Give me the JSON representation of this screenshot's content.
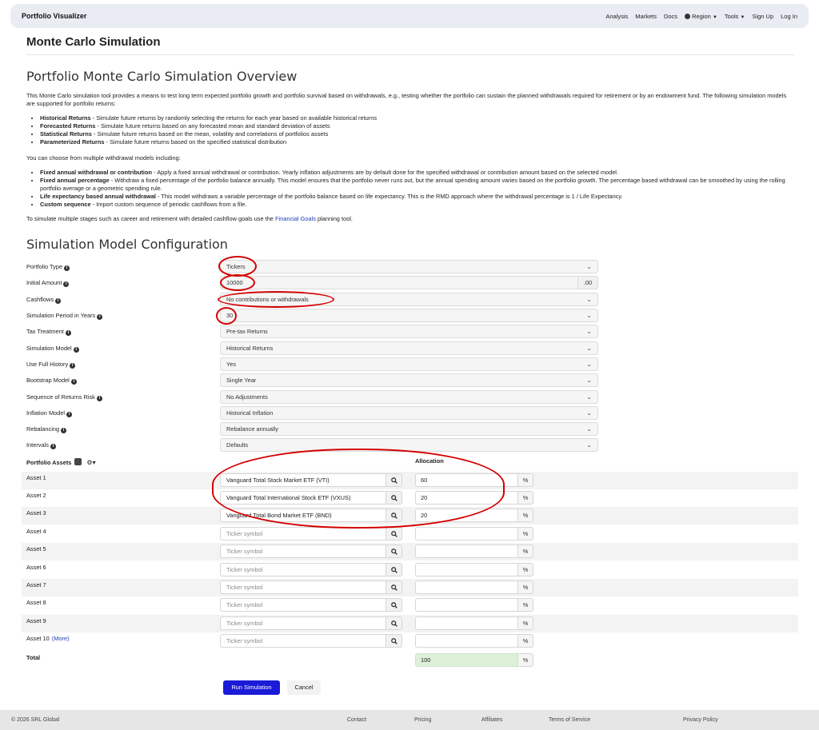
{
  "navbar": {
    "brand": "Portfolio Visualizer",
    "links": [
      "Analysis",
      "Markets",
      "Docs",
      "Region",
      "Tools",
      "Sign Up",
      "Log In"
    ]
  },
  "page_title": "Monte Carlo Simulation",
  "overview": {
    "title": "Portfolio Monte Carlo Simulation Overview",
    "intro": "This Monte Carlo simulation tool provides a means to test long term expected portfolio growth and portfolio survival based on withdrawals, e.g., testing whether the portfolio can sustain the planned withdrawals required for retirement or by an endowment fund. The following simulation models are supported for portfolio returns:",
    "models": [
      {
        "term": "Historical Returns",
        "desc": " - Simulate future returns by randomly selecting the returns for each year based on available historical returns"
      },
      {
        "term": "Forecasted Returns",
        "desc": " - Simulate future returns based on any forecasted mean and standard deviation of assets"
      },
      {
        "term": "Statistical Returns",
        "desc": " - Simulate future returns based on the mean, volatility and correlations of portfolios assets"
      },
      {
        "term": "Parameterized Returns",
        "desc": " - Simulate future returns based on the specified statistical distribution"
      }
    ],
    "withdrawal_intro": "You can choose from multiple withdrawal models including:",
    "withdrawals": [
      {
        "term": "Fixed annual withdrawal or contribution",
        "desc": " - Apply a fixed annual withdrawal or contribution. Yearly inflation adjustments are by default done for the specified withdrawal or contribution amount based on the selected model."
      },
      {
        "term": "Fixed annual percentage",
        "desc": " - Withdraw a fixed percentage of the portfolio balance annually. This model ensures that the portfolio never runs out, but the annual spending amount varies based on the portfolio growth. The percentage based withdrawal can be smoothed by using the rolling portfolio average or a geometric spending rule."
      },
      {
        "term": "Life expectancy based annual withdrawal",
        "desc": " - This model withdraws a variable percentage of the portfolio balance based on life expectancy. This is the RMD approach where the withdrawal percentage is 1 / Life Expectancy."
      },
      {
        "term": "Custom sequence",
        "desc": " - Import custom sequence of periodic cashflows from a file."
      }
    ],
    "stages_pre": "To simulate multiple stages such as career and retirement with detailed cashflow goals use the ",
    "stages_link": "Financial Goals",
    "stages_post": " planning tool."
  },
  "config": {
    "title": "Simulation Model Configuration",
    "fields": [
      {
        "label": "Portfolio Type",
        "value": "Tickers"
      },
      {
        "label": "Initial Amount",
        "value": "10000",
        "suffix": ".00"
      },
      {
        "label": "Cashflows",
        "value": "No contributions or withdrawals"
      },
      {
        "label": "Simulation Period in Years",
        "value": "30"
      },
      {
        "label": "Tax Treatment",
        "value": "Pre-tax Returns"
      },
      {
        "label": "Simulation Model",
        "value": "Historical Returns"
      },
      {
        "label": "Use Full History",
        "value": "Yes"
      },
      {
        "label": "Bootstrap Model",
        "value": "Single Year"
      },
      {
        "label": "Sequence of Returns Risk",
        "value": "No Adjustments"
      },
      {
        "label": "Inflation Model",
        "value": "Historical Inflation"
      },
      {
        "label": "Rebalancing",
        "value": "Rebalance annually"
      },
      {
        "label": "Intervals",
        "value": "Defaults"
      }
    ]
  },
  "assets": {
    "label": "Portfolio Assets",
    "allocation_header": "Allocation",
    "placeholder": "Ticker symbol",
    "percent": "%",
    "more": "(More)",
    "rows": [
      {
        "label": "Asset 1",
        "ticker": "Vanguard Total Stock Market ETF (VTI)",
        "allocation": "60"
      },
      {
        "label": "Asset 2",
        "ticker": "Vanguard Total International Stock ETF (VXUS)",
        "allocation": "20"
      },
      {
        "label": "Asset 3",
        "ticker": "Vanguard Total Bond Market ETF (BND)",
        "allocation": "20"
      },
      {
        "label": "Asset 4",
        "ticker": "",
        "allocation": ""
      },
      {
        "label": "Asset 5",
        "ticker": "",
        "allocation": ""
      },
      {
        "label": "Asset 6",
        "ticker": "",
        "allocation": ""
      },
      {
        "label": "Asset 7",
        "ticker": "",
        "allocation": ""
      },
      {
        "label": "Asset 8",
        "ticker": "",
        "allocation": ""
      },
      {
        "label": "Asset 9",
        "ticker": "",
        "allocation": ""
      },
      {
        "label": "Asset 10",
        "ticker": "",
        "allocation": ""
      }
    ],
    "total_label": "Total",
    "total_value": "100"
  },
  "buttons": {
    "run": "Run Simulation",
    "cancel": "Cancel"
  },
  "footer": {
    "copyright": "© 2026 SRL Global",
    "links": [
      "Contact",
      "Pricing",
      "Affiliates",
      "Terms of Service",
      "Privacy Policy"
    ]
  },
  "colors": {
    "run_button": "#1a1ad8",
    "link": "#1d3fb5",
    "annotation": "#d40000",
    "total_bg": "#dff0d8"
  }
}
